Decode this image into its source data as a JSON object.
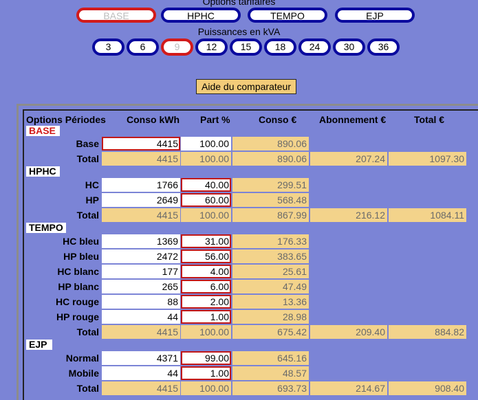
{
  "header": {
    "options_label": "Options tarifaires",
    "power_label": "Puissances en kVA"
  },
  "options": [
    "BASE",
    "HPHC",
    "TEMPO",
    "EJP"
  ],
  "powers": [
    "3",
    "6",
    "9",
    "12",
    "15",
    "18",
    "24",
    "30",
    "36"
  ],
  "help_button": "Aide du comparateur",
  "table": {
    "headers": [
      "Options Périodes",
      "Conso kWh",
      "Part %",
      "Conso €",
      "Abonnement €",
      "Total €"
    ],
    "sections": {
      "base": {
        "title": "BASE",
        "rows": [
          {
            "label": "Base",
            "kwh": "4415",
            "part": "100.00",
            "euro": "890.06"
          }
        ],
        "total": {
          "label": "Total",
          "kwh": "4415",
          "part": "100.00",
          "euro": "890.06",
          "abo": "207.24",
          "tot": "1097.30"
        }
      },
      "hphc": {
        "title": "HPHC",
        "rows": [
          {
            "label": "HC",
            "kwh": "1766",
            "part": "40.00",
            "euro": "299.51"
          },
          {
            "label": "HP",
            "kwh": "2649",
            "part": "60.00",
            "euro": "568.48"
          }
        ],
        "total": {
          "label": "Total",
          "kwh": "4415",
          "part": "100.00",
          "euro": "867.99",
          "abo": "216.12",
          "tot": "1084.11"
        }
      },
      "tempo": {
        "title": "TEMPO",
        "rows": [
          {
            "label": "HC bleu",
            "kwh": "1369",
            "part": "31.00",
            "euro": "176.33"
          },
          {
            "label": "HP bleu",
            "kwh": "2472",
            "part": "56.00",
            "euro": "383.65"
          },
          {
            "label": "HC blanc",
            "kwh": "177",
            "part": "4.00",
            "euro": "25.61"
          },
          {
            "label": "HP blanc",
            "kwh": "265",
            "part": "6.00",
            "euro": "47.49"
          },
          {
            "label": "HC rouge",
            "kwh": "88",
            "part": "2.00",
            "euro": "13.36"
          },
          {
            "label": "HP rouge",
            "kwh": "44",
            "part": "1.00",
            "euro": "28.98"
          }
        ],
        "total": {
          "label": "Total",
          "kwh": "4415",
          "part": "100.00",
          "euro": "675.42",
          "abo": "209.40",
          "tot": "884.82"
        }
      },
      "ejp": {
        "title": "EJP",
        "rows": [
          {
            "label": "Normal",
            "kwh": "4371",
            "part": "99.00",
            "euro": "645.16"
          },
          {
            "label": "Mobile",
            "kwh": "44",
            "part": "1.00",
            "euro": "48.57"
          }
        ],
        "total": {
          "label": "Total",
          "kwh": "4415",
          "part": "100.00",
          "euro": "693.73",
          "abo": "214.67",
          "tot": "908.40"
        }
      }
    }
  }
}
